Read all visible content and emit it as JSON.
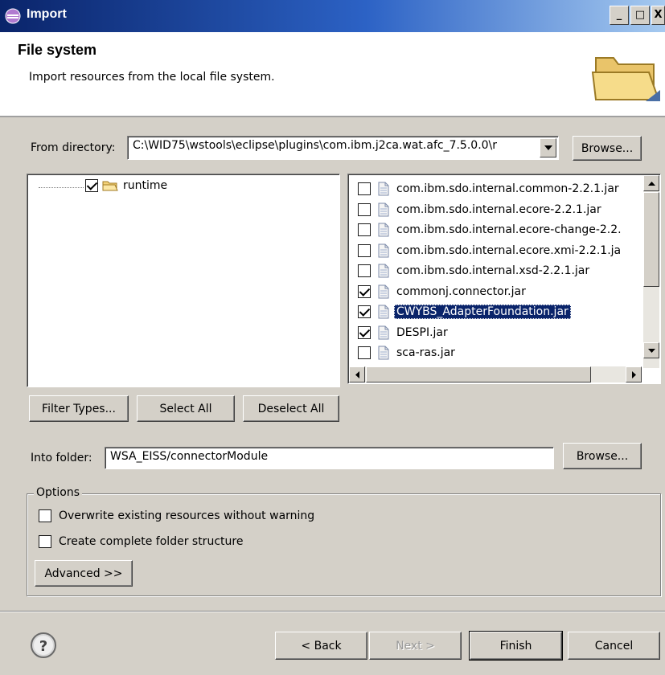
{
  "window": {
    "title": "Import"
  },
  "header": {
    "title": "File system",
    "description": "Import resources from the local file system."
  },
  "from_directory": {
    "label": "From directory:",
    "value": "C:\\WID75\\wstools\\eclipse\\plugins\\com.ibm.j2ca.wat.afc_7.5.0.0\\r",
    "browse_label": "Browse..."
  },
  "tree": {
    "items": [
      {
        "label": "runtime",
        "checked": true
      }
    ]
  },
  "files": [
    {
      "name": "com.ibm.sdo.internal.common-2.2.1.jar",
      "checked": false,
      "selected": false
    },
    {
      "name": "com.ibm.sdo.internal.ecore-2.2.1.jar",
      "checked": false,
      "selected": false
    },
    {
      "name": "com.ibm.sdo.internal.ecore-change-2.2.",
      "checked": false,
      "selected": false
    },
    {
      "name": "com.ibm.sdo.internal.ecore.xmi-2.2.1.ja",
      "checked": false,
      "selected": false
    },
    {
      "name": "com.ibm.sdo.internal.xsd-2.2.1.jar",
      "checked": false,
      "selected": false
    },
    {
      "name": "commonj.connector.jar",
      "checked": true,
      "selected": false
    },
    {
      "name": "CWYBS_AdapterFoundation.jar",
      "checked": true,
      "selected": true
    },
    {
      "name": "DESPI.jar",
      "checked": true,
      "selected": false
    },
    {
      "name": "sca-ras.jar",
      "checked": false,
      "selected": false
    }
  ],
  "buttons": {
    "filter_types": "Filter Types...",
    "select_all": "Select All",
    "deselect_all": "Deselect All",
    "back": "< Back",
    "next": "Next >",
    "finish": "Finish",
    "cancel": "Cancel",
    "advanced": "Advanced >>"
  },
  "into_folder": {
    "label": "Into folder:",
    "value": "WSA_EISS/connectorModule",
    "browse_label": "Browse..."
  },
  "options": {
    "legend": "Options",
    "overwrite": {
      "label": "Overwrite existing resources without warning",
      "checked": false
    },
    "create_structure": {
      "label": "Create complete folder structure",
      "checked": false
    }
  },
  "colors": {
    "selection": "#0a246a",
    "titlebar": "#0a246a",
    "dialog": "#d4d0c8"
  },
  "icons": {
    "help": "help-icon",
    "folder": "folder-icon",
    "file": "file-icon"
  }
}
